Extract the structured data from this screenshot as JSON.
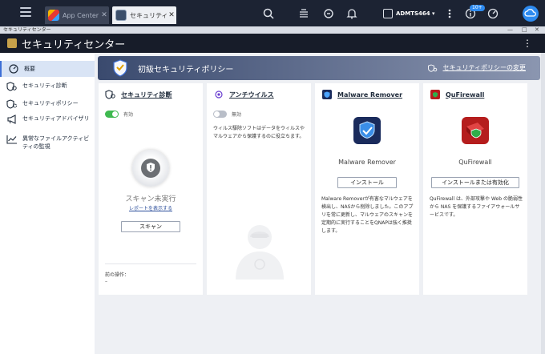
{
  "topbar": {
    "tabs": [
      {
        "label": "App Center",
        "close": "✕"
      },
      {
        "label": "セキュリティ...",
        "close": "✕"
      }
    ],
    "user": "ADMTS464 ▾",
    "badge": "10+"
  },
  "window": {
    "title": "セキュリティセンター",
    "minimize": "—",
    "maximize": "□",
    "close": "✕"
  },
  "app": {
    "title": "セキュリティセンター",
    "menu": "⋮"
  },
  "sidebar": {
    "items": [
      {
        "label": "概要"
      },
      {
        "label": "セキュリティ診断"
      },
      {
        "label": "セキュリティポリシー"
      },
      {
        "label": "セキュリティアドバイザリ"
      },
      {
        "label": "異常なファイルアクティビティの監視"
      }
    ]
  },
  "hero": {
    "title": "初級セキュリティポリシー",
    "link": "セキュリティポリシーの変更"
  },
  "cards": {
    "scan": {
      "title": "セキュリティ診断",
      "toggle_label": "有効",
      "status": "スキャン未実行",
      "report_link": "レポートを表示する",
      "button": "スキャン",
      "prev_label": "前の操作：",
      "prev_value": "–"
    },
    "antivirus": {
      "title": "アンチウイルス",
      "toggle_label": "無効",
      "desc": "ウィルス駆除ソフトはデータをウィルスやマルウェアから保護するのに役立ちます。"
    },
    "malware": {
      "title": "Malware Remover",
      "name": "Malware Remover",
      "button": "インストール",
      "desc": "Malware Removerが有害なマルウェアを検出し、NASから削除しました。このアプリを常に更新し、マルウェアのスキャンを定期的に実行することをQNAPは強く推奨します。"
    },
    "firewall": {
      "title": "QuFirewall",
      "name": "QuFirewall",
      "button": "インストールまたは有効化",
      "desc": "QuFirewall は、外部攻撃や Web の脆弱性から NAS を保護するファイアウォールサービスです。"
    }
  },
  "colors": {
    "topbar": "#1c2333",
    "accent": "#2e8bf0",
    "toggle_on": "#3fb950"
  }
}
